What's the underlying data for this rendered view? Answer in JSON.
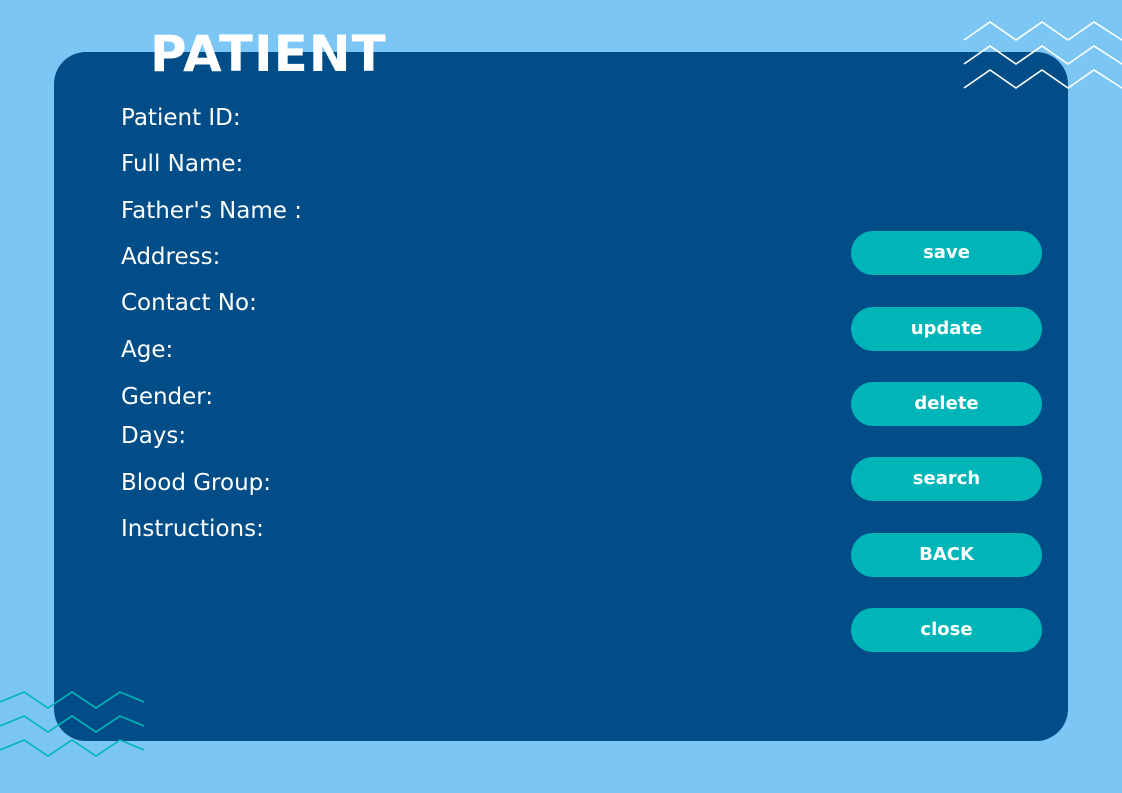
{
  "page": {
    "title": "PATIENT"
  },
  "form": {
    "labels": {
      "patient_id": "Patient ID:",
      "full_name": "Full Name:",
      "father_name": "Father's Name :",
      "address": "Address:",
      "contact_no": "Contact No:",
      "age": "Age:",
      "gender": "Gender:",
      "days": "Days:",
      "blood_group": "Blood Group:",
      "instructions": "Instructions:"
    }
  },
  "actions": {
    "save": "save",
    "update": "update",
    "delete": "delete",
    "search": "search",
    "back": "BACK",
    "close": "close"
  },
  "decorations": {
    "top_right_zigzag_icon": "zigzag-lines-icon",
    "bottom_left_zigzag_icon": "zigzag-lines-icon"
  },
  "colors": {
    "background": "#7cc6f5",
    "panel": "#004d87",
    "button": "#00b5b8",
    "text": "#ffffff",
    "zigzag_top": "#ffffff",
    "zigzag_bottom": "#00b5b8"
  }
}
